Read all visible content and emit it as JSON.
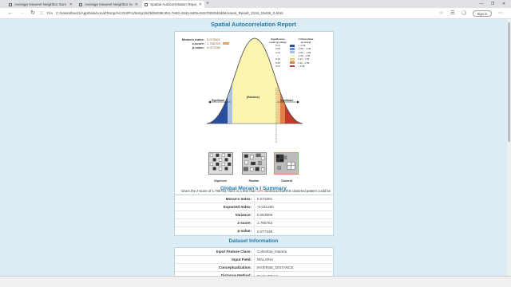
{
  "browser": {
    "tabs": [
      {
        "title": "Average Nearest Neighbor Sum",
        "active": false
      },
      {
        "title": "Average Nearest Neighbor Sum",
        "active": false
      },
      {
        "title": "Spatial Autocorrelation Report",
        "active": true
      }
    ],
    "new_tab_glyph": "+",
    "window_controls": [
      "—",
      "❐",
      "✕"
    ],
    "address": {
      "scheme_label": "File",
      "url": "C:/Users/boel1/AppData/Local/Temp/ArcGISPro/temp15436/5039c451-7e92-4341-840a-91570020d3d/MoransI_Result_3116_15436_0.html"
    },
    "signin_label": "Sign in",
    "icons": {
      "back": "back-arrow-icon",
      "forward": "forward-arrow-icon",
      "reload": "reload-icon"
    }
  },
  "report": {
    "title": "Spatial Autocorrelation Report",
    "stats": [
      {
        "label": "Moran's Index:",
        "value": "0.073301"
      },
      {
        "label": "z-score:",
        "value": "1.765763"
      },
      {
        "label": "p-value:",
        "value": "0.077436"
      }
    ],
    "legend": {
      "col1": "Significance Level (p-value)",
      "col2": "Critical Value (z-score)",
      "rows": [
        {
          "p": "0.01",
          "z": "< -2.58",
          "color": "#2b4f9e"
        },
        {
          "p": "0.05",
          "z": "-2.58 - -1.96",
          "color": "#6b8fcf"
        },
        {
          "p": "0.10",
          "z": "-1.96 - -1.65",
          "color": "#a9c1e5"
        },
        {
          "p": "---",
          "z": "-1.65 - 1.65",
          "color": "#fbf5b0"
        },
        {
          "p": "0.10",
          "z": "1.65 - 1.96",
          "color": "#f5c98a"
        },
        {
          "p": "0.05",
          "z": "1.96 - 2.58",
          "color": "#e0804b"
        },
        {
          "p": "0.01",
          "z": "> 2.58",
          "color": "#c0392b"
        }
      ]
    },
    "curve_labels": {
      "left": "Significant",
      "center": "(Random)",
      "right": "Significant"
    },
    "panels": [
      {
        "label": "Dispersed"
      },
      {
        "label": "Random"
      },
      {
        "label": "Clustered"
      }
    ],
    "summary_a": "Given the z-score of 1.765763, there is a less than ",
    "summary_pct": "10%",
    "summary_b": " likelihood that this clustered pattern could be the result of random chance."
  },
  "global": {
    "heading": "Global Moran's I Summary",
    "rows": [
      {
        "k": "Moran's Index:",
        "v": "0.073301"
      },
      {
        "k": "Expected Index:",
        "v": "-0.031250"
      },
      {
        "k": "Variance:",
        "v": "0.003506"
      },
      {
        "k": "z-score:",
        "v": "1.765763"
      },
      {
        "k": "p-value:",
        "v": "0.077436"
      }
    ]
  },
  "dataset": {
    "heading": "Dataset Information",
    "rows": [
      {
        "k": "Input Feature Class:",
        "v": "Colombia_malaria"
      },
      {
        "k": "Input Field:",
        "v": "MALARIA"
      },
      {
        "k": "Conceptualization:",
        "v": "INVERSE_DISTANCE"
      },
      {
        "k": "Distance Method:",
        "v": "EUCLIDEAN"
      }
    ]
  }
}
